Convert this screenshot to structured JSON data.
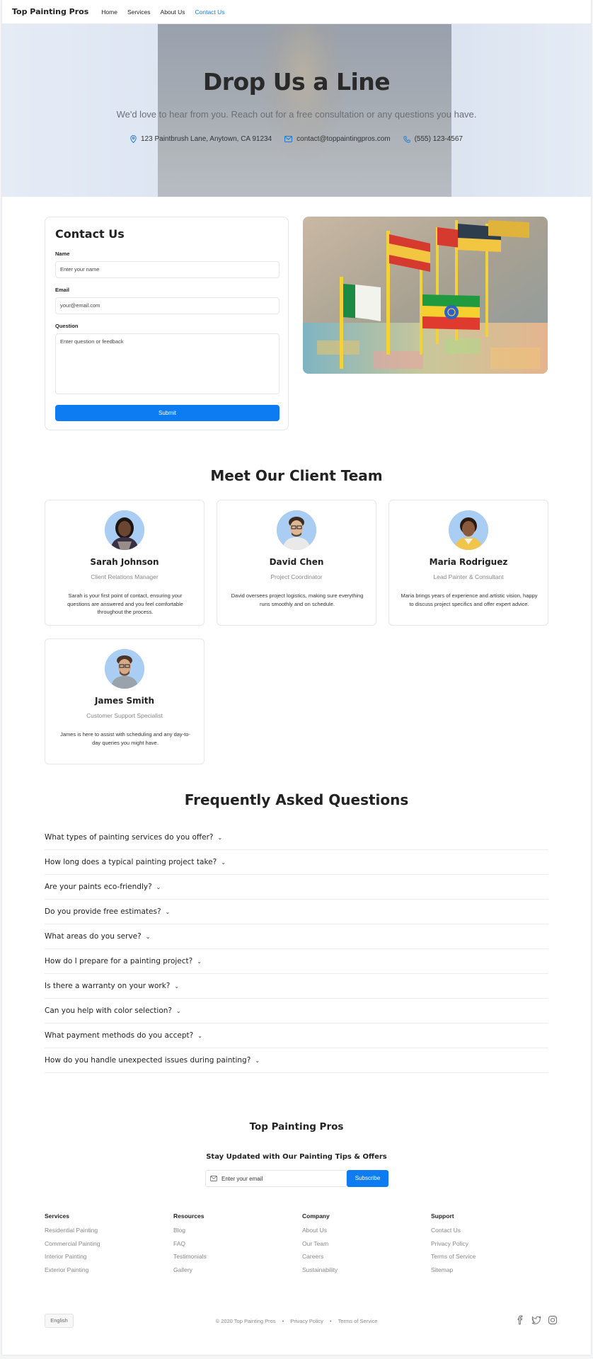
{
  "nav": {
    "brand": "Top Painting Pros",
    "links": [
      "Home",
      "Services",
      "About Us",
      "Contact Us"
    ]
  },
  "hero": {
    "title": "Drop Us a Line",
    "subtitle": "We'd love to hear from you. Reach out for a free consultation or any questions you have.",
    "address": "123 Paintbrush Lane, Anytown, CA 91234",
    "email": "contact@toppaintingpros.com",
    "phone": "(555) 123-4567"
  },
  "contact_form": {
    "title": "Contact Us",
    "name_label": "Name",
    "name_placeholder": "Enter your name",
    "email_label": "Email",
    "email_placeholder": "your@email.com",
    "question_label": "Question",
    "question_placeholder": "Enter question or feedback",
    "submit_label": "Submit"
  },
  "team": {
    "title": "Meet Our Client Team",
    "members": [
      {
        "name": "Sarah Johnson",
        "role": "Client Relations Manager",
        "bio": "Sarah is your first point of contact, ensuring your questions are answered and you feel comfortable throughout the process."
      },
      {
        "name": "David Chen",
        "role": "Project Coordinator",
        "bio": "David oversees project logistics, making sure everything runs smoothly and on schedule."
      },
      {
        "name": "Maria Rodriguez",
        "role": "Lead Painter & Consultant",
        "bio": "Maria brings years of experience and artistic vision, happy to discuss project specifics and offer expert advice."
      },
      {
        "name": "James Smith",
        "role": "Customer Support Specialist",
        "bio": "James is here to assist with scheduling and any day-to-day queries you might have."
      }
    ]
  },
  "faq": {
    "title": "Frequently Asked Questions",
    "items": [
      "What types of painting services do you offer?",
      "How long does a typical painting project take?",
      "Are your paints eco-friendly?",
      "Do you provide free estimates?",
      "What areas do you serve?",
      "How do I prepare for a painting project?",
      "Is there a warranty on your work?",
      "Can you help with color selection?",
      "What payment methods do you accept?",
      "How do you handle unexpected issues during painting?"
    ]
  },
  "footer": {
    "brand": "Top Painting Pros",
    "newsletter_title": "Stay Updated with Our Painting Tips & Offers",
    "newsletter_placeholder": "Enter your email",
    "subscribe_label": "Subscribe",
    "columns": [
      {
        "title": "Services",
        "links": [
          "Residential Painting",
          "Commercial Painting",
          "Interior Painting",
          "Exterior Painting"
        ]
      },
      {
        "title": "Resources",
        "links": [
          "Blog",
          "FAQ",
          "Testimonials",
          "Gallery"
        ]
      },
      {
        "title": "Company",
        "links": [
          "About Us",
          "Our Team",
          "Careers",
          "Sustainability"
        ]
      },
      {
        "title": "Support",
        "links": [
          "Contact Us",
          "Privacy Policy",
          "Terms of Service",
          "Sitemap"
        ]
      }
    ],
    "language": "English",
    "copyright": "© 2020 Top Painting Pros",
    "privacy": "Privacy Policy",
    "terms": "Terms of Service",
    "social_icons": [
      "facebook-icon",
      "twitter-icon",
      "instagram-icon"
    ]
  },
  "colors": {
    "accent": "#0d7cf2",
    "active_nav": "#1a7ad8"
  }
}
